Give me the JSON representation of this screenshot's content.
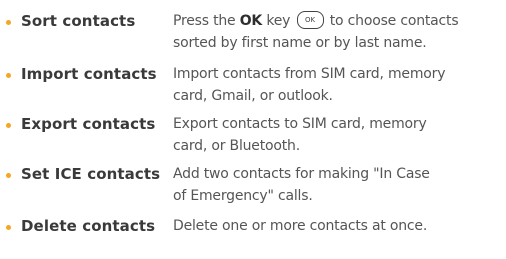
{
  "colors": {
    "bullet": "#f5a623",
    "term_text": "#3a3a3a",
    "desc_text": "#555555"
  },
  "items": [
    {
      "term": "Sort contacts",
      "desc_before": "Press the ",
      "desc_bold": "OK",
      "desc_mid": " key ",
      "key_icon_label": "OK",
      "desc_line1_after": " to choose contacts",
      "desc_line2": "sorted by first name or by last name."
    },
    {
      "term": "Import contacts",
      "desc_line1": "Import contacts from SIM card, memory",
      "desc_line2": "card, Gmail, or outlook."
    },
    {
      "term": "Export contacts",
      "desc_line1": "Export contacts to SIM card, memory",
      "desc_line2": "card, or Bluetooth."
    },
    {
      "term": "Set ICE contacts",
      "desc_line1": "Add two contacts for making \"In Case",
      "desc_line2": "of Emergency\" calls."
    },
    {
      "term": "Delete contacts",
      "desc_line1": "Delete one or more contacts at once."
    }
  ]
}
